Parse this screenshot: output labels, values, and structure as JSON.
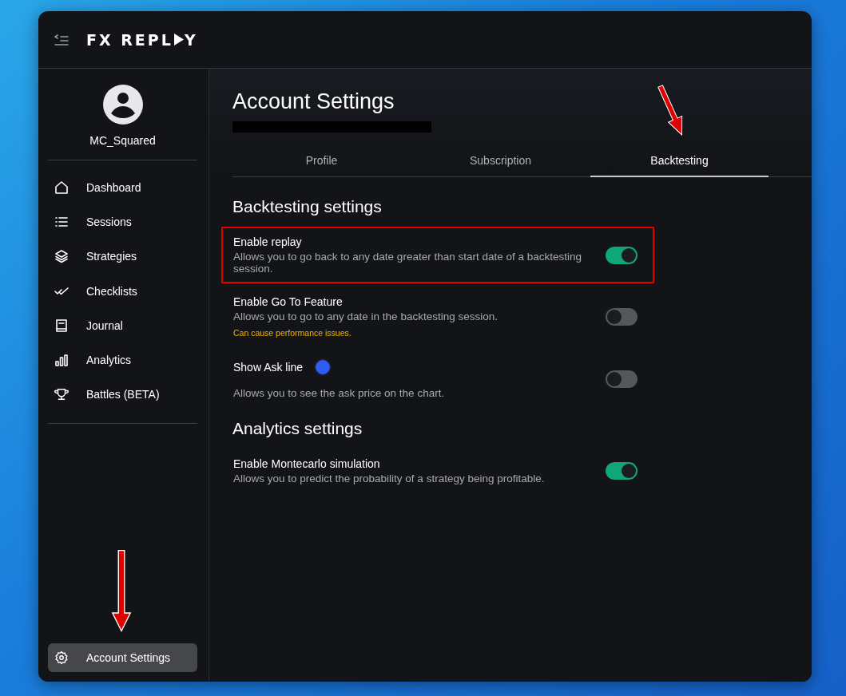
{
  "top_bar": {
    "logo": {
      "before": "FX REPL",
      "after": "Y"
    }
  },
  "profile": {
    "username": "MC_Squared"
  },
  "sidebar": {
    "items": [
      {
        "label": "Dashboard",
        "selected": false
      },
      {
        "label": "Sessions",
        "selected": false
      },
      {
        "label": "Strategies",
        "selected": false
      },
      {
        "label": "Checklists",
        "selected": false
      },
      {
        "label": "Journal",
        "selected": false
      },
      {
        "label": "Analytics",
        "selected": false
      },
      {
        "label": "Battles (BETA)",
        "selected": false
      }
    ],
    "footer_item": {
      "label": "Account Settings",
      "selected": true,
      "annotated": true
    }
  },
  "page": {
    "title": "Account Settings",
    "redacted": true,
    "tabs": [
      {
        "label": "Profile",
        "selected": false,
        "annotated": false
      },
      {
        "label": "Subscription",
        "selected": false,
        "annotated": false
      },
      {
        "label": "Backtesting",
        "selected": true,
        "annotated": true
      }
    ],
    "sections": [
      {
        "title": "Backtesting settings",
        "settings": [
          {
            "kind": "toggle",
            "title": "Enable replay",
            "description": "Allows you to go back to any date greater than start date of a backtesting session.",
            "on": true,
            "highlighted": true
          },
          {
            "kind": "toggle",
            "title": "Enable Go To Feature",
            "description": "Allows you to go to any date in the backtesting session.",
            "warning": "Can cause performance issues.",
            "on": false,
            "highlighted": false
          },
          {
            "kind": "toggle",
            "title": "Show Ask line",
            "color": "#2f5cf5",
            "description": "Allows you to see the ask price on the chart.",
            "on": false,
            "highlighted": false
          }
        ]
      },
      {
        "title": "Analytics settings",
        "settings": [
          {
            "kind": "toggle",
            "title": "Enable Montecarlo simulation",
            "description": "Allows you to predict the probability of a strategy being profitable.",
            "on": true,
            "highlighted": false
          }
        ]
      }
    ]
  }
}
